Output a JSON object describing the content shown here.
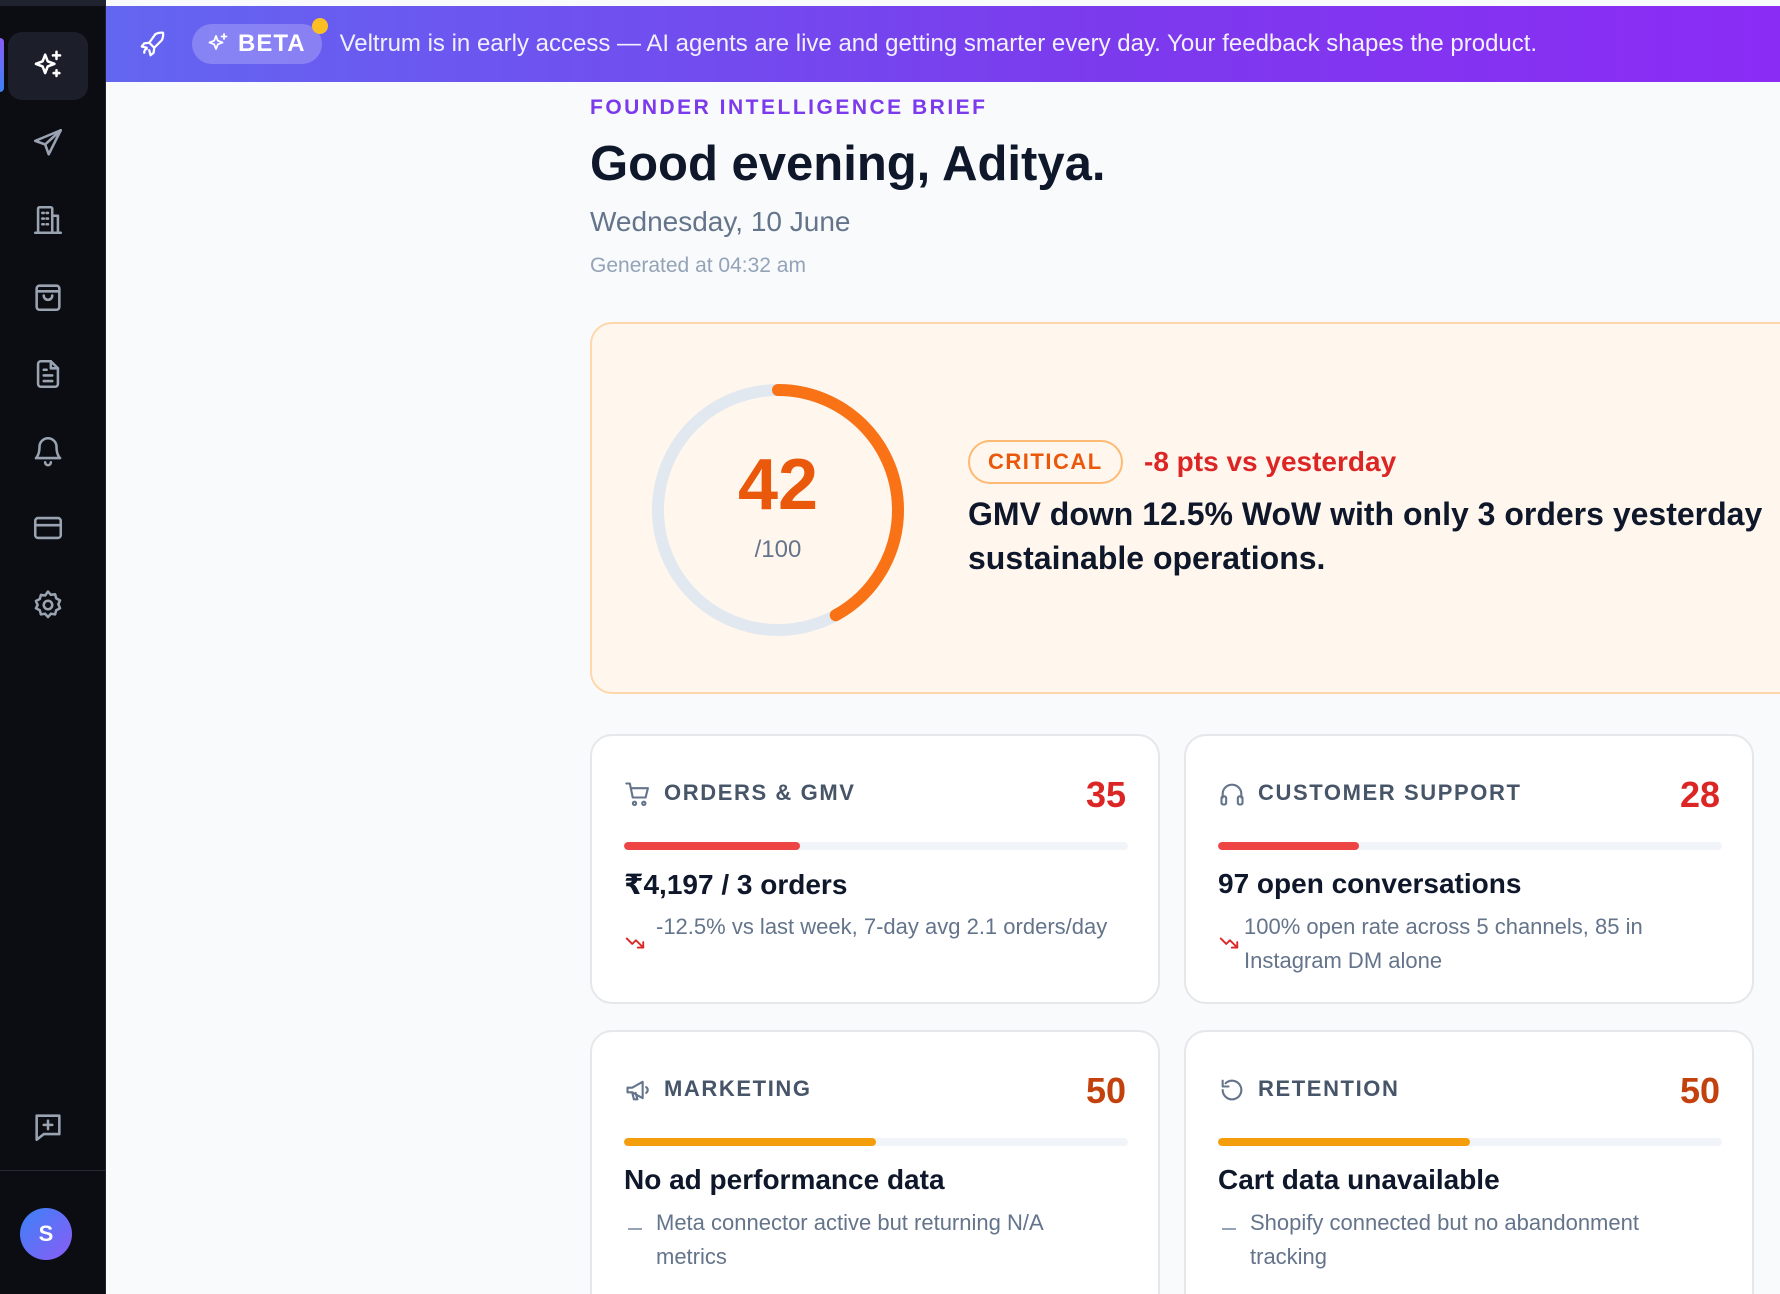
{
  "banner": {
    "beta_label": "BETA",
    "text": "Veltrum is in early access — AI agents are live and getting smarter every day. Your feedback shapes the product."
  },
  "sidebar": {
    "items": [
      {
        "icon": "sparkles-icon",
        "active": true
      },
      {
        "icon": "send-icon"
      },
      {
        "icon": "building-icon"
      },
      {
        "icon": "shopping-bag-icon"
      },
      {
        "icon": "document-icon"
      },
      {
        "icon": "bell-icon"
      },
      {
        "icon": "credit-card-icon"
      },
      {
        "icon": "settings-icon"
      }
    ],
    "feedback_icon": "message-plus-icon",
    "avatar_initial": "S"
  },
  "header": {
    "eyebrow": "FOUNDER INTELLIGENCE BRIEF",
    "greeting": "Good evening, Aditya.",
    "date": "Wednesday, 10 June",
    "generated": "Generated at 04:32 am"
  },
  "health": {
    "score": "42",
    "score_value": 42,
    "max": "/100",
    "status": "CRITICAL",
    "delta": "-8 pts vs yesterday",
    "summary": "GMV down 12.5% WoW with only 3 orders yesterday sustainable operations.",
    "colors": {
      "accent": "#f97316",
      "track": "#e2e8f0",
      "score": "#ea580c"
    }
  },
  "cards": [
    {
      "title": "ORDERS & GMV",
      "score": "35",
      "score_value": 35,
      "icon": "cart-icon",
      "color": "#ef4444",
      "score_color": "#dc2626",
      "headline": "₹4,197 / 3 orders",
      "trend": "down",
      "detail": "-12.5% vs last week, 7-day avg 2.1 orders/day"
    },
    {
      "title": "CUSTOMER SUPPORT",
      "score": "28",
      "score_value": 28,
      "icon": "headphones-icon",
      "color": "#ef4444",
      "score_color": "#dc2626",
      "headline": "97 open conversations",
      "trend": "down",
      "detail": "100% open rate across 5 channels, 85 in Instagram DM alone"
    },
    {
      "title": "MARKETING",
      "score": "50",
      "score_value": 50,
      "icon": "megaphone-icon",
      "color": "#f59e0b",
      "score_color": "#c2410c",
      "headline": "No ad performance data",
      "trend": "flat",
      "detail": "Meta connector active but returning N/A metrics"
    },
    {
      "title": "RETENTION",
      "score": "50",
      "score_value": 50,
      "icon": "refresh-icon",
      "color": "#f59e0b",
      "score_color": "#c2410c",
      "headline": "Cart data unavailable",
      "trend": "flat",
      "detail": "Shopify connected but no abandonment tracking"
    }
  ]
}
